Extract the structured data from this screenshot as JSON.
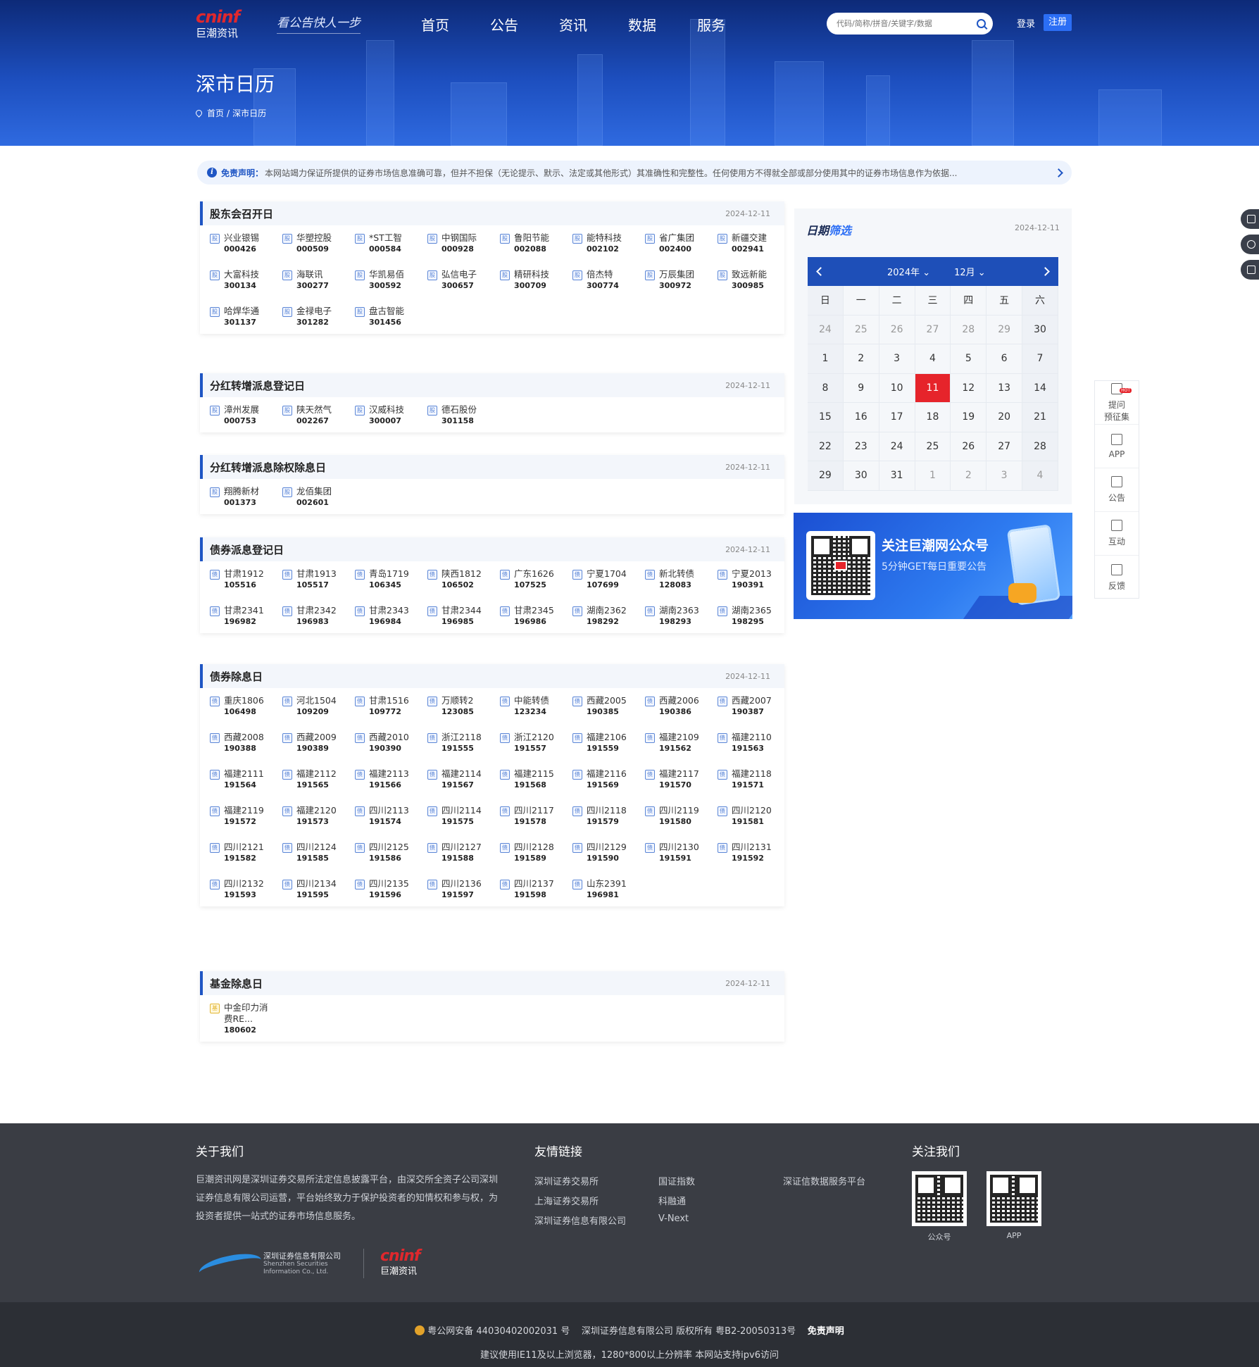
{
  "header": {
    "logo_en": "cninf",
    "logo_cn": "巨潮资讯",
    "slogan": "看公告快人一步",
    "nav": [
      "首页",
      "公告",
      "资讯",
      "数据",
      "服务"
    ],
    "search_placeholder": "代码/简称/拼音/关键字/数据",
    "login": "登录",
    "register": "注册",
    "page_title": "深市日历",
    "breadcrumb_home": "首页",
    "breadcrumb_sep": "/",
    "breadcrumb_current": "深市日历"
  },
  "disclaimer": {
    "label": "免责声明：",
    "text": "本网站竭力保证所提供的证券市场信息准确可靠，但并不担保（无论提示、默示、法定或其他形式）其准确性和完整性。任何使用方不得就全部或部分使用其中的证券市场信息作为依据..."
  },
  "sections": [
    {
      "title": "股东会召开日",
      "date": "2024-12-11",
      "badge": "股",
      "items": [
        [
          "兴业银锡",
          "000426"
        ],
        [
          "华塑控股",
          "000509"
        ],
        [
          "*ST工智",
          "000584"
        ],
        [
          "中钢国际",
          "000928"
        ],
        [
          "鲁阳节能",
          "002088"
        ],
        [
          "能特科技",
          "002102"
        ],
        [
          "省广集团",
          "002400"
        ],
        [
          "新疆交建",
          "002941"
        ],
        [
          "大富科技",
          "300134"
        ],
        [
          "海联讯",
          "300277"
        ],
        [
          "华凯易佰",
          "300592"
        ],
        [
          "弘信电子",
          "300657"
        ],
        [
          "精研科技",
          "300709"
        ],
        [
          "倍杰特",
          "300774"
        ],
        [
          "万辰集团",
          "300972"
        ],
        [
          "致远新能",
          "300985"
        ],
        [
          "哈焊华通",
          "301137"
        ],
        [
          "金禄电子",
          "301282"
        ],
        [
          "盘古智能",
          "301456"
        ]
      ]
    },
    {
      "title": "分红转增派息登记日",
      "date": "2024-12-11",
      "badge": "股",
      "items": [
        [
          "漳州发展",
          "000753"
        ],
        [
          "陕天然气",
          "002267"
        ],
        [
          "汉威科技",
          "300007"
        ],
        [
          "德石股份",
          "301158"
        ]
      ]
    },
    {
      "title": "分红转增派息除权除息日",
      "date": "2024-12-11",
      "badge": "股",
      "items": [
        [
          "翔腾新材",
          "001373"
        ],
        [
          "龙佰集团",
          "002601"
        ]
      ]
    },
    {
      "title": "债券派息登记日",
      "date": "2024-12-11",
      "badge": "债",
      "items": [
        [
          "甘肃1912",
          "105516"
        ],
        [
          "甘肃1913",
          "105517"
        ],
        [
          "青岛1719",
          "106345"
        ],
        [
          "陕西1812",
          "106502"
        ],
        [
          "广东1626",
          "107525"
        ],
        [
          "宁夏1704",
          "107699"
        ],
        [
          "新北转债",
          "128083"
        ],
        [
          "宁夏2013",
          "190391"
        ],
        [
          "甘肃2341",
          "196982"
        ],
        [
          "甘肃2342",
          "196983"
        ],
        [
          "甘肃2343",
          "196984"
        ],
        [
          "甘肃2344",
          "196985"
        ],
        [
          "甘肃2345",
          "196986"
        ],
        [
          "湖南2362",
          "198292"
        ],
        [
          "湖南2363",
          "198293"
        ],
        [
          "湖南2365",
          "198295"
        ]
      ]
    },
    {
      "title": "债券除息日",
      "date": "2024-12-11",
      "badge": "债",
      "items": [
        [
          "重庆1806",
          "106498"
        ],
        [
          "河北1504",
          "109209"
        ],
        [
          "甘肃1516",
          "109772"
        ],
        [
          "万顺转2",
          "123085"
        ],
        [
          "中能转债",
          "123234"
        ],
        [
          "西藏2005",
          "190385"
        ],
        [
          "西藏2006",
          "190386"
        ],
        [
          "西藏2007",
          "190387"
        ],
        [
          "西藏2008",
          "190388"
        ],
        [
          "西藏2009",
          "190389"
        ],
        [
          "西藏2010",
          "190390"
        ],
        [
          "浙江2118",
          "191555"
        ],
        [
          "浙江2120",
          "191557"
        ],
        [
          "福建2106",
          "191559"
        ],
        [
          "福建2109",
          "191562"
        ],
        [
          "福建2110",
          "191563"
        ],
        [
          "福建2111",
          "191564"
        ],
        [
          "福建2112",
          "191565"
        ],
        [
          "福建2113",
          "191566"
        ],
        [
          "福建2114",
          "191567"
        ],
        [
          "福建2115",
          "191568"
        ],
        [
          "福建2116",
          "191569"
        ],
        [
          "福建2117",
          "191570"
        ],
        [
          "福建2118",
          "191571"
        ],
        [
          "福建2119",
          "191572"
        ],
        [
          "福建2120",
          "191573"
        ],
        [
          "四川2113",
          "191574"
        ],
        [
          "四川2114",
          "191575"
        ],
        [
          "四川2117",
          "191578"
        ],
        [
          "四川2118",
          "191579"
        ],
        [
          "四川2119",
          "191580"
        ],
        [
          "四川2120",
          "191581"
        ],
        [
          "四川2121",
          "191582"
        ],
        [
          "四川2124",
          "191585"
        ],
        [
          "四川2125",
          "191586"
        ],
        [
          "四川2127",
          "191588"
        ],
        [
          "四川2128",
          "191589"
        ],
        [
          "四川2129",
          "191590"
        ],
        [
          "四川2130",
          "191591"
        ],
        [
          "四川2131",
          "191592"
        ],
        [
          "四川2132",
          "191593"
        ],
        [
          "四川2134",
          "191595"
        ],
        [
          "四川2135",
          "191596"
        ],
        [
          "四川2136",
          "191597"
        ],
        [
          "四川2137",
          "191598"
        ],
        [
          "山东2391",
          "196981"
        ]
      ]
    },
    {
      "title": "基金除息日",
      "date": "2024-12-11",
      "badge": "基",
      "fund": true,
      "items": [
        [
          "中金印力消费RE...",
          "180602"
        ]
      ]
    }
  ],
  "calendar": {
    "title_a": "日期",
    "title_b": "筛选",
    "date": "2024-12-11",
    "year_label": "2024年",
    "month_label": "12月",
    "weekdays": [
      "日",
      "一",
      "二",
      "三",
      "四",
      "五",
      "六"
    ],
    "days": [
      24,
      25,
      26,
      27,
      28,
      29,
      30,
      1,
      2,
      3,
      4,
      5,
      6,
      7,
      8,
      9,
      10,
      11,
      12,
      13,
      14,
      15,
      16,
      17,
      18,
      19,
      20,
      21,
      22,
      23,
      24,
      25,
      26,
      27,
      28,
      29,
      30,
      31,
      1,
      2,
      3,
      4
    ],
    "other_month_before": 6,
    "other_month_after": 4,
    "today": 11
  },
  "promo": {
    "title": "关注巨潮网公众号",
    "subtitle": "5分钟GET每日重要公告"
  },
  "sidetools": [
    {
      "label_a": "提问",
      "label_b": "预征集",
      "hot": "HOT",
      "icon": "question-icon"
    },
    {
      "label_a": "APP",
      "label_b": "",
      "icon": "phone-icon"
    },
    {
      "label_a": "公告",
      "label_b": "",
      "icon": "doc-search-icon"
    },
    {
      "label_a": "互动",
      "label_b": "",
      "icon": "edit-icon"
    },
    {
      "label_a": "反馈",
      "label_b": "",
      "icon": "chat-icon"
    }
  ],
  "footer": {
    "about_title": "关于我们",
    "about_text": "巨潮资讯网是深圳证券交易所法定信息披露平台，由深交所全资子公司深圳证券信息有限公司运营，平台始终致力于保护投资者的知情权和参与权，为投资者提供一站式的证券市场信息服务。",
    "sz_logo_cn": "深圳证券信息有限公司",
    "sz_logo_en1": "Shenzhen Securities",
    "sz_logo_en2": "Information Co., Ltd.",
    "links_title": "友情链接",
    "links": [
      "深圳证券交易所",
      "国证指数",
      "深证信数据服务平台",
      "上海证券交易所",
      "科融通",
      "深圳证券信息有限公司",
      "V-Next"
    ],
    "follow_title": "关注我们",
    "qr1": "公众号",
    "qr2": "APP",
    "icp": "粤公网安备 44030402002031 号",
    "copyright": "深圳证券信息有限公司 版权所有 粤B2-20050313号",
    "disclaimer_link": "免责声明",
    "browser_note": "建议使用IE11及以上浏览器，1280*800以上分辨率 本网站支持ipv6访问"
  }
}
